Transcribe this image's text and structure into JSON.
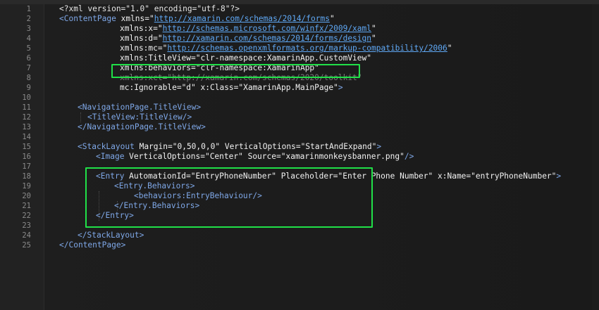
{
  "editor": {
    "lines": [
      {
        "n": "1",
        "tokens": [
          {
            "t": "<?xml version=\"1.0\" encoding=\"utf-8\"?>",
            "c": "pi"
          }
        ]
      },
      {
        "n": "2",
        "tokens": [
          {
            "t": "<",
            "c": "tag"
          },
          {
            "t": "ContentPage",
            "c": "tag"
          },
          {
            "t": " xmlns=",
            "c": "attr"
          },
          {
            "t": "\"",
            "c": "str"
          },
          {
            "t": "http://xamarin.com/schemas/2014/forms",
            "c": "url"
          },
          {
            "t": "\"",
            "c": "str"
          }
        ]
      },
      {
        "n": "3",
        "tokens": [
          {
            "t": "xmlns:x=",
            "c": "attr"
          },
          {
            "t": "\"",
            "c": "str"
          },
          {
            "t": "http://schemas.microsoft.com/winfx/2009/xaml",
            "c": "url"
          },
          {
            "t": "\"",
            "c": "str"
          }
        ]
      },
      {
        "n": "4",
        "tokens": [
          {
            "t": "xmlns:d=",
            "c": "attr"
          },
          {
            "t": "\"",
            "c": "str"
          },
          {
            "t": "http://xamarin.com/schemas/2014/forms/design",
            "c": "url"
          },
          {
            "t": "\"",
            "c": "str"
          }
        ]
      },
      {
        "n": "5",
        "tokens": [
          {
            "t": "xmlns:mc=",
            "c": "attr"
          },
          {
            "t": "\"",
            "c": "str"
          },
          {
            "t": "http://schemas.openxmlformats.org/markup-compatibility/2006",
            "c": "url"
          },
          {
            "t": "\"",
            "c": "str"
          }
        ]
      },
      {
        "n": "6",
        "tokens": [
          {
            "t": "xmlns:TitleView=",
            "c": "attr"
          },
          {
            "t": "\"clr-namespace:XamarinApp.CustomView\"",
            "c": "str"
          }
        ]
      },
      {
        "n": "7",
        "tokens": [
          {
            "t": "xmlns:behaviors=",
            "c": "attr"
          },
          {
            "t": "\"clr-namespace:XamarinApp\"",
            "c": "str"
          }
        ]
      },
      {
        "n": "8",
        "tokens": [
          {
            "t": "xmlns:xct=",
            "c": "dim"
          },
          {
            "t": "\"",
            "c": "dim"
          },
          {
            "t": "http://xamarin.com/schemas/2020/toolkit",
            "c": "dim"
          },
          {
            "t": "\"",
            "c": "dim"
          }
        ]
      },
      {
        "n": "9",
        "tokens": [
          {
            "t": "mc:Ignorable=",
            "c": "attr"
          },
          {
            "t": "\"d\"",
            "c": "str"
          },
          {
            "t": " x:Class=",
            "c": "attr"
          },
          {
            "t": "\"XamarinApp.MainPage\"",
            "c": "str"
          },
          {
            "t": ">",
            "c": "tag"
          }
        ]
      },
      {
        "n": "10",
        "tokens": []
      },
      {
        "n": "11",
        "tokens": [
          {
            "t": "<",
            "c": "tag"
          },
          {
            "t": "NavigationPage.TitleView",
            "c": "tag"
          },
          {
            "t": ">",
            "c": "tag"
          }
        ]
      },
      {
        "n": "12",
        "tokens": [
          {
            "t": "<",
            "c": "tag"
          },
          {
            "t": "TitleView:TitleView",
            "c": "tag"
          },
          {
            "t": "/>",
            "c": "tag"
          }
        ]
      },
      {
        "n": "13",
        "tokens": [
          {
            "t": "</",
            "c": "tag"
          },
          {
            "t": "NavigationPage.TitleView",
            "c": "tag"
          },
          {
            "t": ">",
            "c": "tag"
          }
        ]
      },
      {
        "n": "14",
        "tokens": []
      },
      {
        "n": "15",
        "tokens": [
          {
            "t": "<",
            "c": "tag"
          },
          {
            "t": "StackLayout",
            "c": "tag"
          },
          {
            "t": " Margin=",
            "c": "attr"
          },
          {
            "t": "\"0,50,0,0\"",
            "c": "str"
          },
          {
            "t": " VerticalOptions=",
            "c": "attr"
          },
          {
            "t": "\"StartAndExpand\"",
            "c": "str"
          },
          {
            "t": ">",
            "c": "tag"
          }
        ]
      },
      {
        "n": "16",
        "tokens": [
          {
            "t": "<",
            "c": "tag"
          },
          {
            "t": "Image",
            "c": "tag"
          },
          {
            "t": " VerticalOptions=",
            "c": "attr"
          },
          {
            "t": "\"Center\"",
            "c": "str"
          },
          {
            "t": " Source=",
            "c": "attr"
          },
          {
            "t": "\"xamarinmonkeysbanner.png\"",
            "c": "str"
          },
          {
            "t": "/>",
            "c": "tag"
          }
        ]
      },
      {
        "n": "17",
        "tokens": []
      },
      {
        "n": "18",
        "tokens": [
          {
            "t": "<",
            "c": "tag"
          },
          {
            "t": "Entry",
            "c": "tag"
          },
          {
            "t": " AutomationId=",
            "c": "attr"
          },
          {
            "t": "\"EntryPhoneNumber\"",
            "c": "str"
          },
          {
            "t": " Placeholder=",
            "c": "attr"
          },
          {
            "t": "\"Enter Phone Number\"",
            "c": "str"
          },
          {
            "t": " x:Name=",
            "c": "attr"
          },
          {
            "t": "\"entryPhoneNumber\"",
            "c": "str"
          },
          {
            "t": ">",
            "c": "tag"
          }
        ]
      },
      {
        "n": "19",
        "tokens": [
          {
            "t": "<",
            "c": "tag"
          },
          {
            "t": "Entry.Behaviors",
            "c": "tag"
          },
          {
            "t": ">",
            "c": "tag"
          }
        ]
      },
      {
        "n": "20",
        "tokens": [
          {
            "t": "<",
            "c": "tag"
          },
          {
            "t": "behaviors:EntryBehaviour",
            "c": "tag"
          },
          {
            "t": "/>",
            "c": "tag"
          }
        ]
      },
      {
        "n": "21",
        "tokens": [
          {
            "t": "</",
            "c": "tag"
          },
          {
            "t": "Entry.Behaviors",
            "c": "tag"
          },
          {
            "t": ">",
            "c": "tag"
          }
        ]
      },
      {
        "n": "22",
        "tokens": [
          {
            "t": "</",
            "c": "tag"
          },
          {
            "t": "Entry",
            "c": "tag"
          },
          {
            "t": ">",
            "c": "tag"
          }
        ]
      },
      {
        "n": "23",
        "tokens": []
      },
      {
        "n": "24",
        "tokens": [
          {
            "t": "</",
            "c": "tag"
          },
          {
            "t": "StackLayout",
            "c": "tag"
          },
          {
            "t": ">",
            "c": "tag"
          }
        ]
      },
      {
        "n": "25",
        "tokens": [
          {
            "t": "</",
            "c": "tag"
          },
          {
            "t": "ContentPage",
            "c": "tag"
          },
          {
            "t": ">",
            "c": "tag"
          }
        ]
      }
    ]
  },
  "colors": {
    "background": "#1e1e1e",
    "highlight_box": "#20e048",
    "tag": "#7fa8e8",
    "url": "#5fa8f5"
  }
}
